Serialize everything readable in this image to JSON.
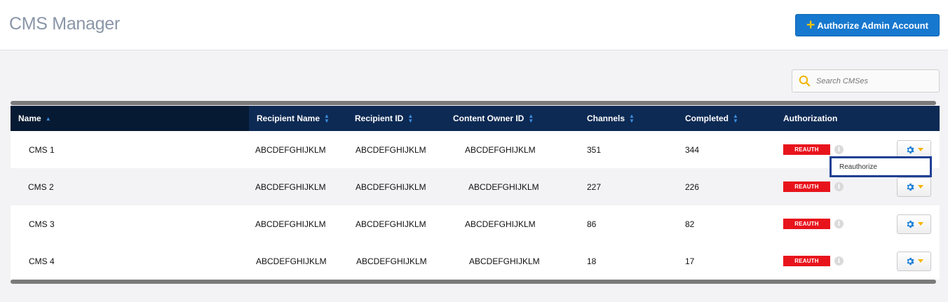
{
  "header": {
    "title": "CMS Manager",
    "authorize_button": {
      "icon": "plus-icon",
      "label": "Authorize Admin Account"
    }
  },
  "search": {
    "placeholder": "Search CMSes"
  },
  "table": {
    "columns": [
      {
        "label": "Name",
        "sort": "asc"
      },
      {
        "label": "Recipient Name",
        "sort": "both"
      },
      {
        "label": "Recipient ID",
        "sort": "both"
      },
      {
        "label": "Content Owner ID",
        "sort": "both"
      },
      {
        "label": "Channels",
        "sort": "both"
      },
      {
        "label": "Completed",
        "sort": "both"
      },
      {
        "label": "Authorization",
        "sort": "none"
      }
    ],
    "rows": [
      {
        "name": "CMS 1",
        "recipient_name": "ABCDEFGHIJKLM",
        "recipient_id": "ABCDEFGHIJKLM",
        "content_owner_id": "ABCDEFGHIJKLM",
        "channels": "351",
        "completed": "344",
        "status": "REAUTH"
      },
      {
        "name": "CMS 2",
        "recipient_name": "ABCDEFGHIJKLM",
        "recipient_id": "ABCDEFGHIJKLM",
        "content_owner_id": "ABCDEFGHIJKLM",
        "channels": "227",
        "completed": "226",
        "status": "REAUTH"
      },
      {
        "name": "CMS 3",
        "recipient_name": "ABCDEFGHIJKLM",
        "recipient_id": "ABCDEFGHIJKLM",
        "content_owner_id": "ABCDEFGHIJKLM",
        "channels": "86",
        "completed": "82",
        "status": "REAUTH"
      },
      {
        "name": "CMS 4",
        "recipient_name": "ABCDEFGHIJKLM",
        "recipient_id": "ABCDEFGHIJKLM",
        "content_owner_id": "ABCDEFGHIJKLM",
        "channels": "18",
        "completed": "17",
        "status": "REAUTH"
      }
    ]
  },
  "dropdown_menu": {
    "items": [
      {
        "label": "Reauthorize"
      }
    ]
  },
  "colors": {
    "accent": "#1778cf",
    "header_bg": "#0d2a54",
    "reauth_badge": "#e8141c",
    "gear": "#1a7fd6",
    "caret": "#f5b400"
  }
}
